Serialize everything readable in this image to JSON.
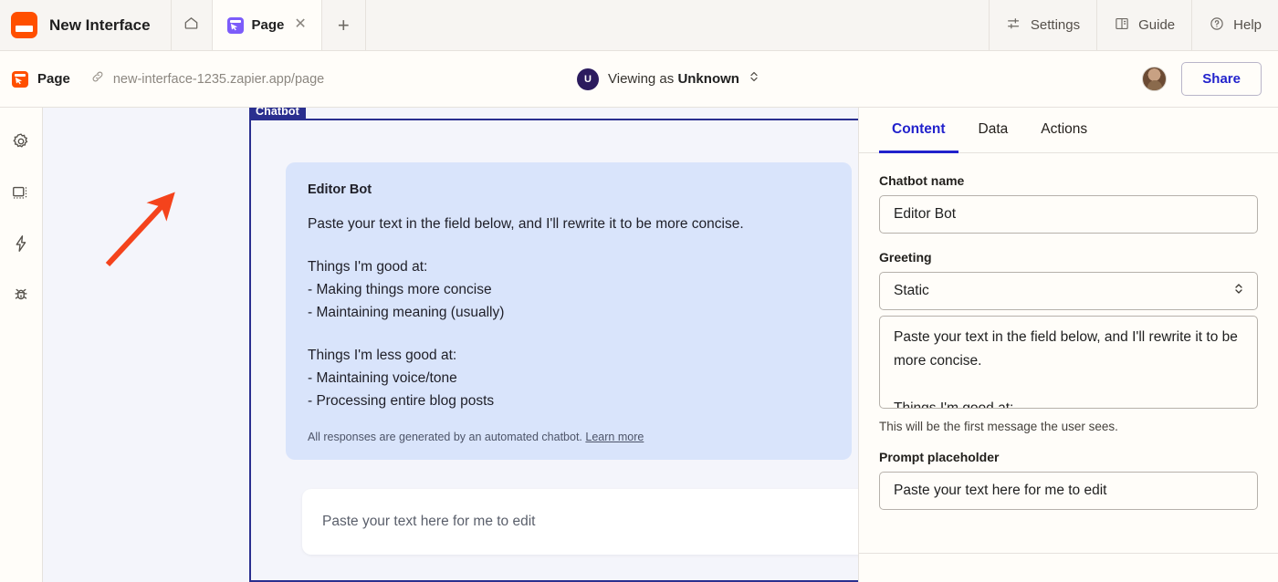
{
  "topbar": {
    "brand_title": "New Interface",
    "logo_color": "#ff4f00",
    "home_icon": "home-icon",
    "tab": {
      "label": "Page",
      "icon": "page-cursor-icon",
      "close_icon": "close-icon",
      "color": "#7c5cfa"
    },
    "new_tab_icon": "plus-icon",
    "actions": [
      {
        "label": "Settings",
        "icon": "sliders-icon"
      },
      {
        "label": "Guide",
        "icon": "book-icon"
      },
      {
        "label": "Help",
        "icon": "question-circle-icon"
      }
    ]
  },
  "subbar": {
    "page_label": "Page",
    "page_icon": "page-cursor-icon",
    "link_icon": "link-icon",
    "url": "new-interface-1235.zapier.app/page",
    "viewing_as": {
      "avatar_initial": "U",
      "prefix": "Viewing as ",
      "name": "Unknown",
      "chevron_icon": "chevron-updown-icon"
    },
    "avatar_name": "user-avatar",
    "share_label": "Share",
    "share_color": "#2222cc"
  },
  "rail": {
    "items": [
      {
        "name": "settings-gear-icon"
      },
      {
        "name": "layout-icon"
      },
      {
        "name": "lightning-bolt-icon"
      },
      {
        "name": "bug-icon"
      }
    ]
  },
  "canvas": {
    "component_badge": "Chatbot",
    "badge_color": "#2a2f8f",
    "bubble": {
      "bot_name": "Editor Bot",
      "paragraphs": [
        "Paste your text in the field below, and I'll rewrite it to be more concise.",
        "Things I'm good at:\n- Making things more concise\n- Maintaining meaning (usually)",
        "Things I'm less good at:\n- Maintaining voice/tone\n- Processing entire blog posts"
      ],
      "disclaimer": "All responses are generated by an automated chatbot.",
      "disclaimer_link": "Learn more"
    },
    "prompt_placeholder": "Paste your text here for me to edit",
    "annotation": {
      "name": "red-arrow-annotation",
      "color": "#f4431c"
    }
  },
  "panel": {
    "tabs": [
      {
        "label": "Content",
        "active": true
      },
      {
        "label": "Data",
        "active": false
      },
      {
        "label": "Actions",
        "active": false
      }
    ],
    "fields": {
      "chatbot_name_label": "Chatbot name",
      "chatbot_name_value": "Editor Bot",
      "greeting_label": "Greeting",
      "greeting_select_value": "Static",
      "greeting_text": "Paste your text in the field below, and I'll rewrite it to be more concise.\n\nThings I'm good at:",
      "greeting_help": "This will be the first message the user sees.",
      "prompt_placeholder_label": "Prompt placeholder",
      "prompt_placeholder_value": "Paste your text here for me to edit"
    }
  }
}
